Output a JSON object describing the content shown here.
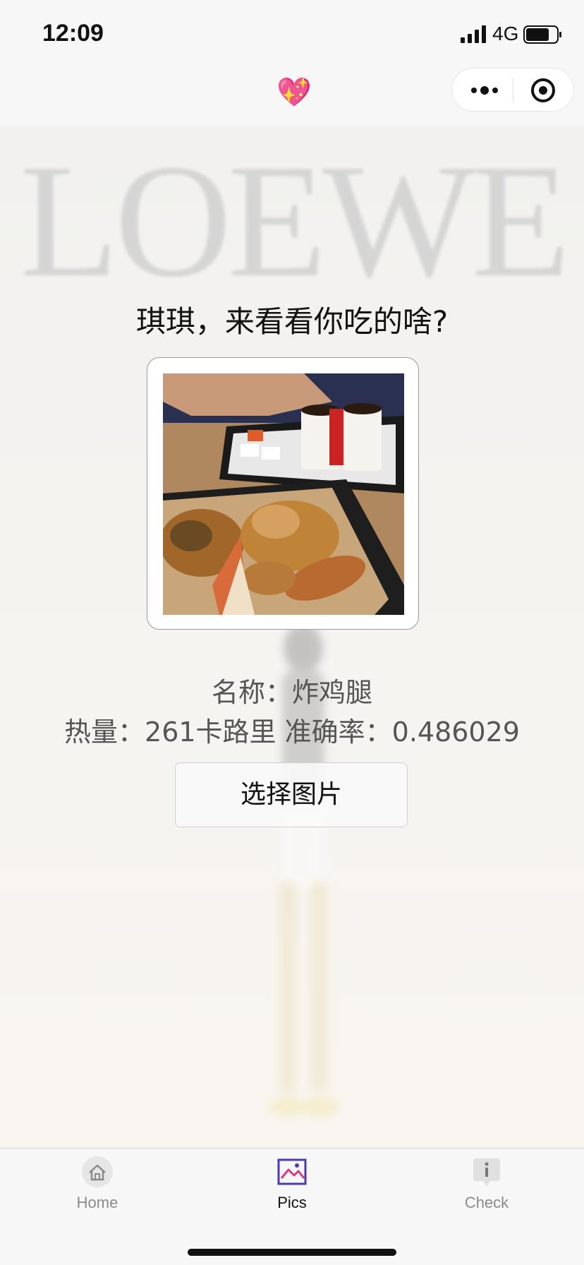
{
  "status_bar": {
    "time": "12:09",
    "network": "4G",
    "signal_icon": "signal-bars-icon",
    "battery_icon": "battery-icon"
  },
  "nav_bar": {
    "title_emoji": "💖",
    "more_icon": "more-dots-icon",
    "close_icon": "target-close-icon"
  },
  "background": {
    "logo_text": "LOEWE"
  },
  "main": {
    "headline": "琪琪，来看看你吃的啥?",
    "photo_alt": "fried chicken photo",
    "result_name": "名称：炸鸡腿",
    "result_detail": "热量：261卡路里 准确率：0.486029",
    "choose_button": "选择图片"
  },
  "tab_bar": {
    "tabs": [
      {
        "label": "Home",
        "icon": "home-icon",
        "active": false
      },
      {
        "label": "Pics",
        "icon": "picture-icon",
        "active": true
      },
      {
        "label": "Check",
        "icon": "info-icon",
        "active": false
      }
    ]
  },
  "colors": {
    "accent": "#4b3bb0",
    "text_primary": "#111111",
    "text_secondary": "#555555",
    "tab_inactive": "#8a8a8a"
  }
}
